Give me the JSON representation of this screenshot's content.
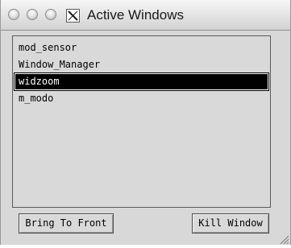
{
  "window": {
    "title": "Active Windows"
  },
  "titlebar": {
    "controls": [
      {
        "name": "close",
        "icon": "circle-icon"
      },
      {
        "name": "minimize",
        "icon": "circle-icon"
      },
      {
        "name": "zoom",
        "icon": "circle-icon"
      }
    ],
    "app_icon": "x11-icon"
  },
  "window_list": {
    "items": [
      {
        "label": "mod_sensor",
        "selected": false
      },
      {
        "label": "Window_Manager",
        "selected": false
      },
      {
        "label": "widzoom",
        "selected": true
      },
      {
        "label": "m_modo",
        "selected": false
      }
    ]
  },
  "buttons": {
    "bring_to_front": "Bring To Front",
    "kill_window": "Kill Window"
  },
  "colors": {
    "window_bg": "#d8d8d8",
    "selection_bg": "#000000",
    "selection_fg": "#ffffff"
  }
}
